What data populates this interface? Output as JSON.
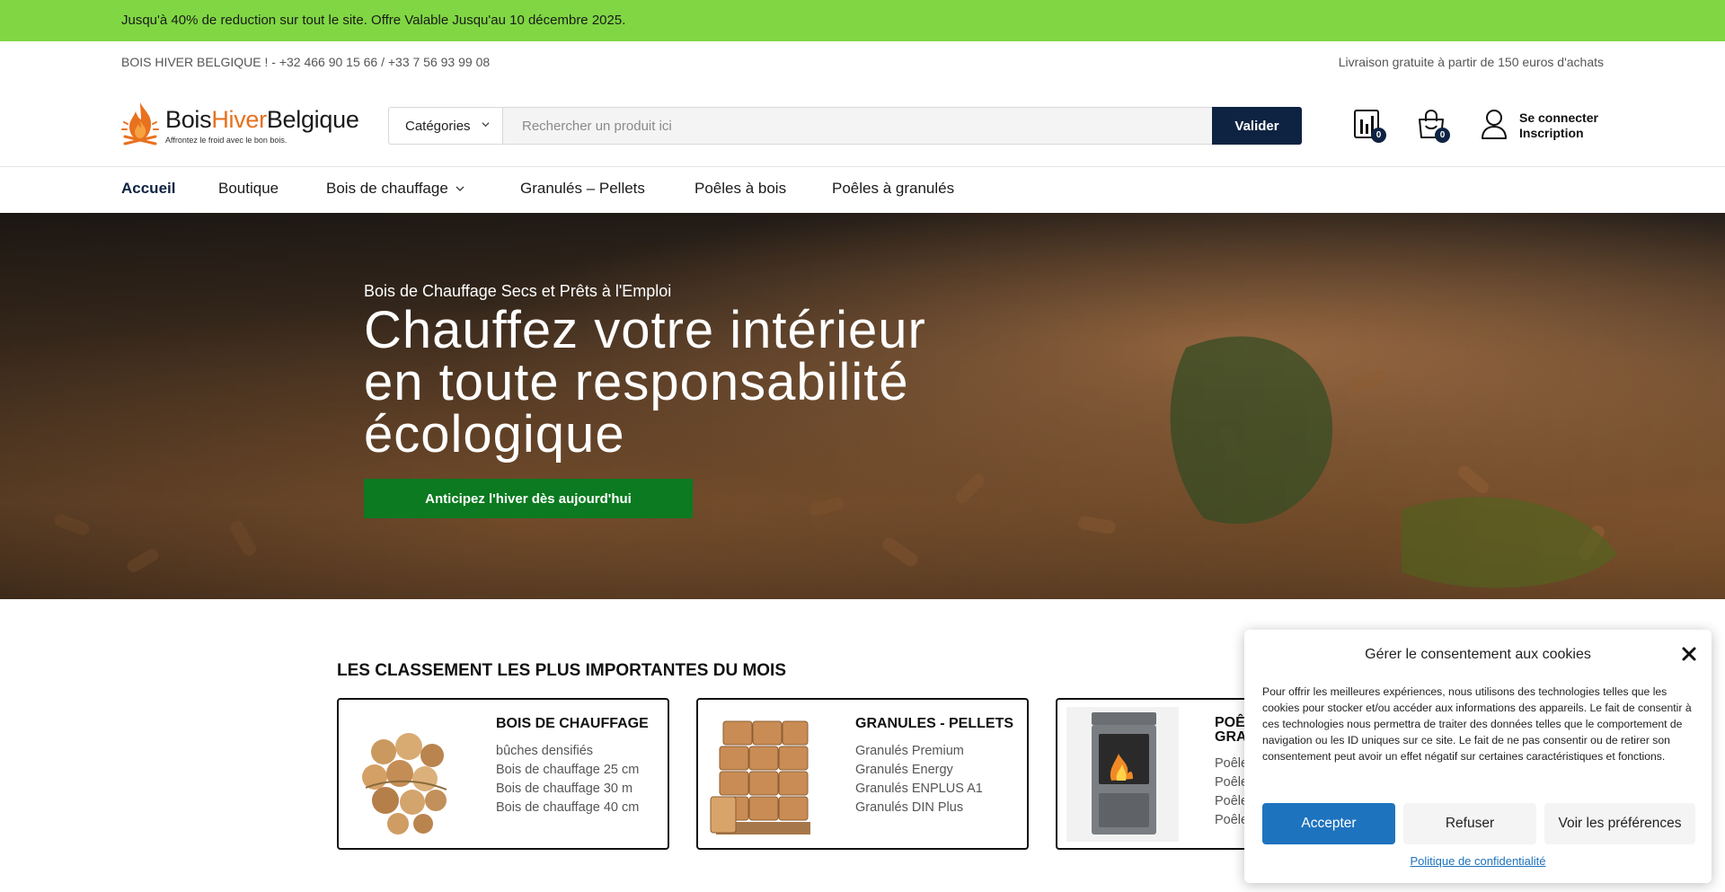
{
  "promo": {
    "text": "Jusqu'à 40% de reduction sur tout le site. Offre Valable Jusqu'au 10 décembre 2025."
  },
  "topbar": {
    "contact": "BOIS HIVER BELGIQUE ! - +32 466 90 15 66 / +33 7 56 93 99 08",
    "shipping": "Livraison gratuite à partir de 150 euros d'achats"
  },
  "logo": {
    "part1": "Bois",
    "part2": "Hiver",
    "part3": "Belgique",
    "tagline": "Affrontez le froid avec le bon bois."
  },
  "search": {
    "category_label": "Catégories",
    "placeholder": "Rechercher un produit ici",
    "button": "Valider"
  },
  "header_icons": {
    "compare_count": "0",
    "cart_count": "0"
  },
  "account": {
    "login": "Se connecter",
    "register": "Inscription"
  },
  "nav": {
    "items": [
      "Accueil",
      "Boutique",
      "Bois de chauffage",
      "Granulés – Pellets",
      "Poêles à bois",
      "Poêles à granulés"
    ]
  },
  "hero": {
    "subtitle": "Bois de Chauffage Secs et Prêts à l'Emploi",
    "title_line1": "Chauffez votre intérieur",
    "title_line2": "en toute responsabilité",
    "title_line3": "écologique",
    "cta": "Anticipez l'hiver dès aujourd'hui"
  },
  "section": {
    "title": "LES CLASSEMENT LES PLUS IMPORTANTES DU MOIS",
    "cards": [
      {
        "title": "BOIS DE CHAUFFAGE",
        "items": [
          "bûches densifiés",
          "Bois de chauffage 25 cm",
          "Bois de chauffage 30 m",
          "Bois de chauffage 40 cm"
        ]
      },
      {
        "title": "GRANULES - PELLETS",
        "items": [
          "Granulés Premium",
          "Granulés Energy",
          "Granulés ENPLUS A1",
          "Granulés DIN Plus"
        ]
      },
      {
        "title_line1": "POÊ",
        "title_line2": "GRA",
        "items": [
          "Poêle",
          "Poêle",
          "Poêle",
          "Poêle"
        ]
      }
    ]
  },
  "cookie": {
    "title": "Gérer le consentement aux cookies",
    "body": "Pour offrir les meilleures expériences, nous utilisons des technologies telles que les cookies pour stocker et/ou accéder aux informations des appareils. Le fait de consentir à ces technologies nous permettra de traiter des données telles que le comportement de navigation ou les ID uniques sur ce site. Le fait de ne pas consentir ou de retirer son consentement peut avoir un effet négatif sur certaines caractéristiques et fonctions.",
    "accept": "Accepter",
    "refuse": "Refuser",
    "preferences": "Voir les préférences",
    "policy": "Politique de confidentialité"
  },
  "colors": {
    "promo_bg": "#80d743",
    "navy": "#0e2342",
    "accent_orange": "#e8711f",
    "cta_green": "#0b7a20",
    "cookie_blue": "#1e73be"
  }
}
